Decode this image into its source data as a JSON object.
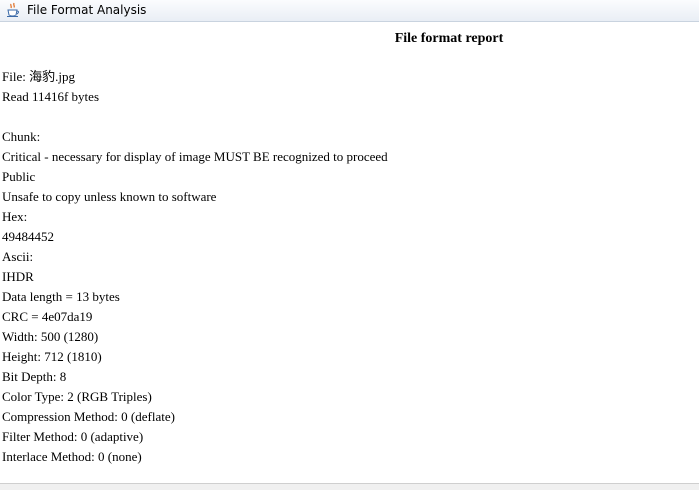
{
  "window": {
    "title": "File Format Analysis",
    "icon": "java-cup-icon"
  },
  "report": {
    "heading": "File format report",
    "file_line": "File: 海豹.jpg",
    "read_line": "Read 11416f bytes",
    "chunk_label": "Chunk:",
    "critical": "Critical - necessary for display of image MUST BE recognized to proceed",
    "public": "Public",
    "unsafe": "Unsafe to copy unless known to software",
    "hex_label": "Hex:",
    "hex_value": "49484452",
    "ascii_label": "Ascii:",
    "ascii_value": "IHDR",
    "data_length": "Data length = 13 bytes",
    "crc": "CRC = 4e07da19",
    "width": "Width: 500 (1280)",
    "height": "Height: 712 (1810)",
    "bit_depth": "Bit Depth: 8",
    "color_type": "Color Type: 2 (RGB Triples)",
    "compression": "Compression Method: 0 (deflate)",
    "filter": "Filter Method: 0 (adaptive)",
    "interlace": "Interlace Method: 0 (none)"
  }
}
